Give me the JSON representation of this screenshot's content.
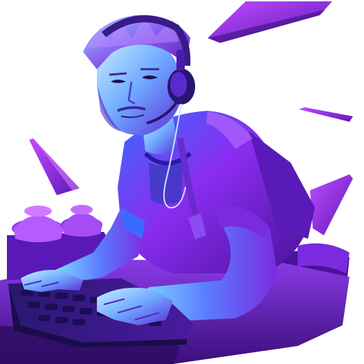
{
  "image": {
    "subject": "gamer-illustration",
    "palette": {
      "background": "#ffffff",
      "deep_purple": "#3a0f7a",
      "purple": "#7a2be0",
      "violet": "#a24cf0",
      "magenta": "#c24cff",
      "cyan": "#38d6ff",
      "blue": "#2f6bff",
      "skin_light": "#bfe9ff",
      "skin_shadow": "#5a3bd8"
    }
  }
}
